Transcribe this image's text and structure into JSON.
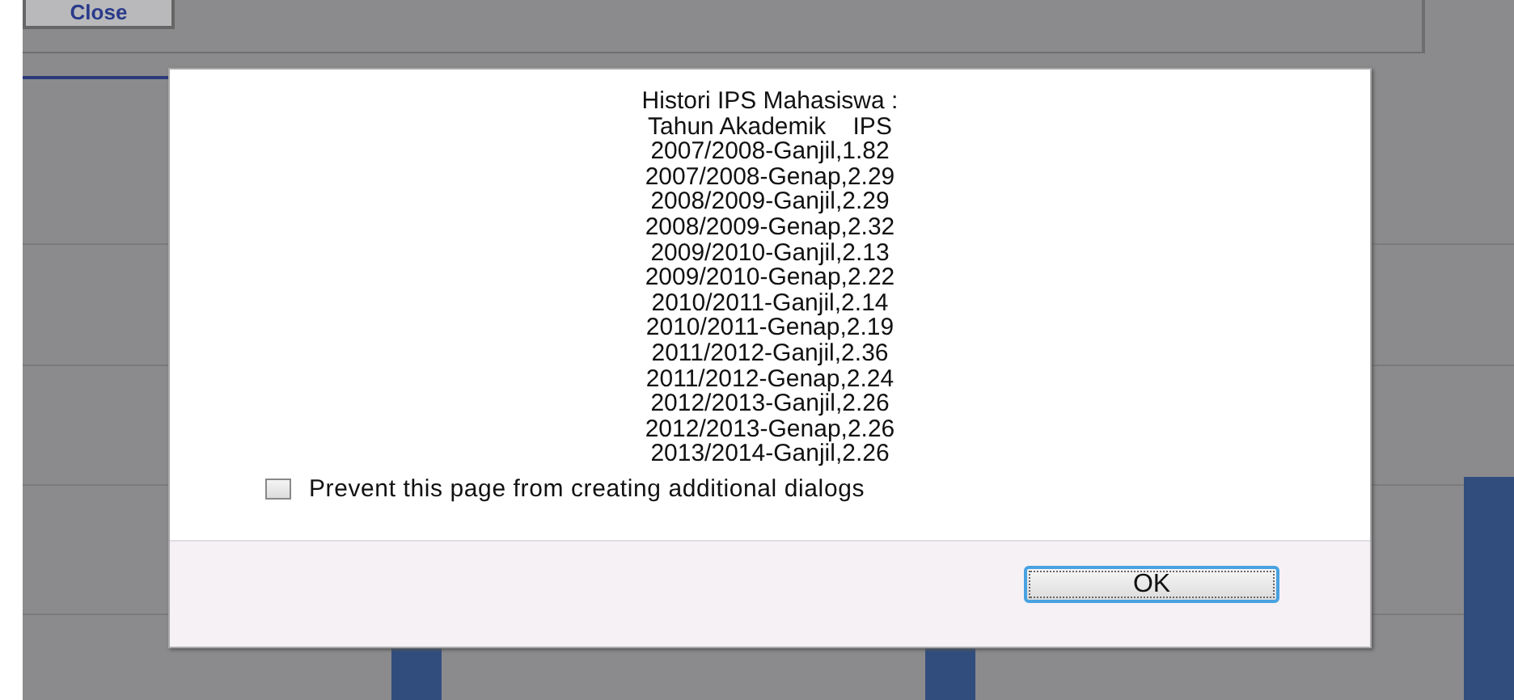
{
  "toolbar": {
    "close_button": "Close"
  },
  "dialog": {
    "lines": [
      "Histori IPS Mahasiswa :",
      "Tahun Akademik    IPS",
      "2007/2008-Ganjil,1.82",
      "2007/2008-Genap,2.29",
      "2008/2009-Ganjil,2.29",
      "2008/2009-Genap,2.32",
      "2009/2010-Ganjil,2.13",
      "2009/2010-Genap,2.22",
      "2010/2011-Ganjil,2.14",
      "2010/2011-Genap,2.19",
      "2011/2012-Ganjil,2.36",
      "2011/2012-Genap,2.24",
      "2012/2013-Ganjil,2.26",
      "2012/2013-Genap,2.26",
      "2013/2014-Ganjil,2.26"
    ],
    "prevent_dialogs": {
      "label": "Prevent this page from creating additional dialogs",
      "checked": false
    },
    "ok_button": "OK"
  }
}
